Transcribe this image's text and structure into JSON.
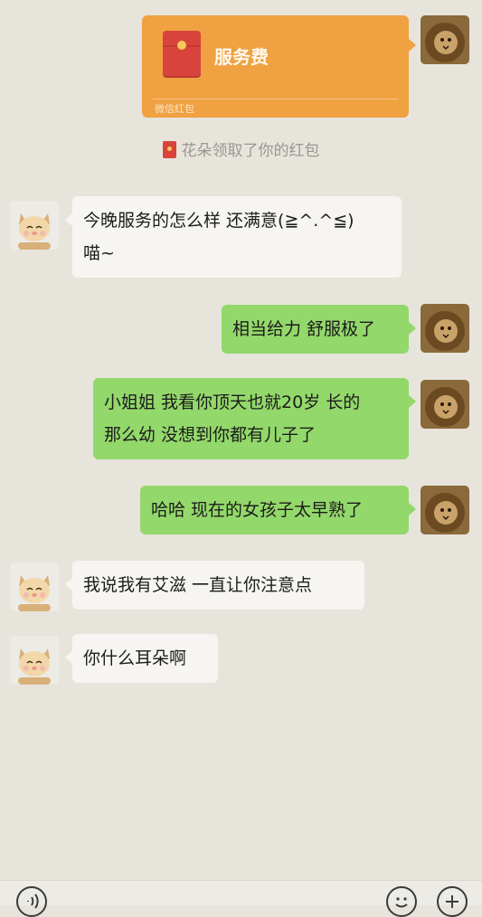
{
  "red_packet": {
    "title": "服务费",
    "label": "微信红包",
    "color": "#f0a141"
  },
  "system_notice": "花朵领取了你的红包",
  "messages": [
    {
      "side": "left",
      "lines": [
        "今晚服务的怎么样 还满意(≧^.^≦)",
        "喵~"
      ]
    },
    {
      "side": "right",
      "lines": [
        "相当给力 舒服极了"
      ]
    },
    {
      "side": "right",
      "lines": [
        "小姐姐 我看你顶天也就20岁 长的",
        "那么幼 没想到你都有儿子了"
      ]
    },
    {
      "side": "right",
      "lines": [
        "哈哈 现在的女孩子太早熟了"
      ]
    },
    {
      "side": "left",
      "lines": [
        "我说我有艾滋 一直让你注意点"
      ]
    },
    {
      "side": "left",
      "lines": [
        "你什么耳朵啊"
      ]
    }
  ],
  "icons": {
    "self_avatar": "lion-avatar",
    "other_avatar": "cat-avatar",
    "voice": "voice-icon",
    "emoji": "emoji-icon",
    "more": "plus-icon"
  },
  "colors": {
    "background": "#e7e4dc",
    "bubble_self": "#93d86a",
    "bubble_other": "#f6f5f1"
  }
}
